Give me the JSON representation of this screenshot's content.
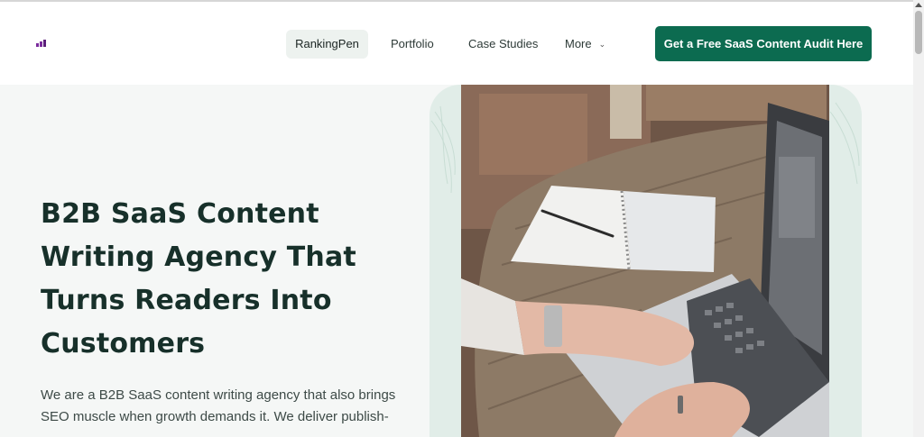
{
  "nav": {
    "items": [
      {
        "label": "RankingPen"
      },
      {
        "label": "Portfolio"
      },
      {
        "label": "Case Studies"
      },
      {
        "label": "More"
      }
    ],
    "more_icon": "chevron-down-icon",
    "cta_label": "Get a Free SaaS Content Audit Here"
  },
  "hero": {
    "title": "B2B SaaS Content Writing Agency That Turns Readers Into Customers",
    "description": "We are a B2B SaaS content writing agency that also brings SEO muscle when growth demands it. We deliver publish-",
    "image": "woman-typing-on-laptop-photo"
  },
  "colors": {
    "accent": "#0c6b50",
    "hero_bg": "#f5f7f6",
    "frame_bg": "#e1ede8",
    "title": "#17302a"
  }
}
